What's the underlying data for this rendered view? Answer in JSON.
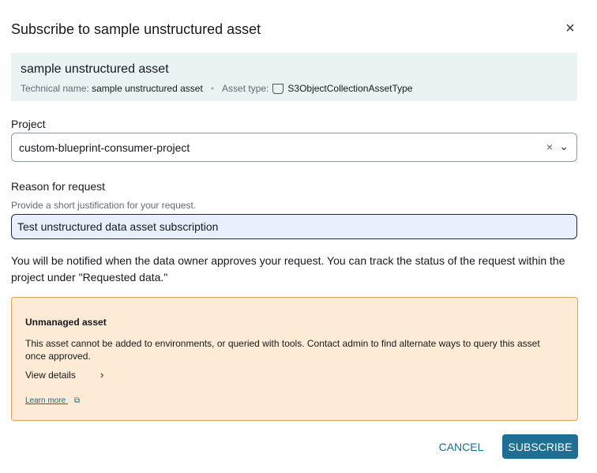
{
  "dialog": {
    "title": "Subscribe to sample unstructured asset",
    "close_icon": "×"
  },
  "asset": {
    "name": "sample unstructured asset",
    "technical_name_label": "Technical name:",
    "technical_name": "sample unstructured asset",
    "separator": "•",
    "asset_type_label": "Asset type:",
    "asset_type": "S3ObjectCollectionAssetType"
  },
  "project": {
    "label": "Project",
    "value": "custom-blueprint-consumer-project",
    "clear_icon": "×",
    "chevron_icon": "⌄"
  },
  "reason": {
    "label": "Reason for request",
    "hint": "Provide a short justification for your request.",
    "value": "Test unstructured data asset subscription"
  },
  "notice": "You will be notified when the data owner approves your request. You can track the status of the request within the project under \"Requested data.\"",
  "warning": {
    "title": "Unmanaged asset",
    "text": "This asset cannot be added to environments, or queried with tools. Contact admin to find alternate ways to query this asset once approved.",
    "view_details": "View details",
    "chevron": "›",
    "learn_more": "Learn more",
    "external_icon": "⧉"
  },
  "buttons": {
    "cancel": "CANCEL",
    "subscribe": "SUBSCRIBE"
  }
}
